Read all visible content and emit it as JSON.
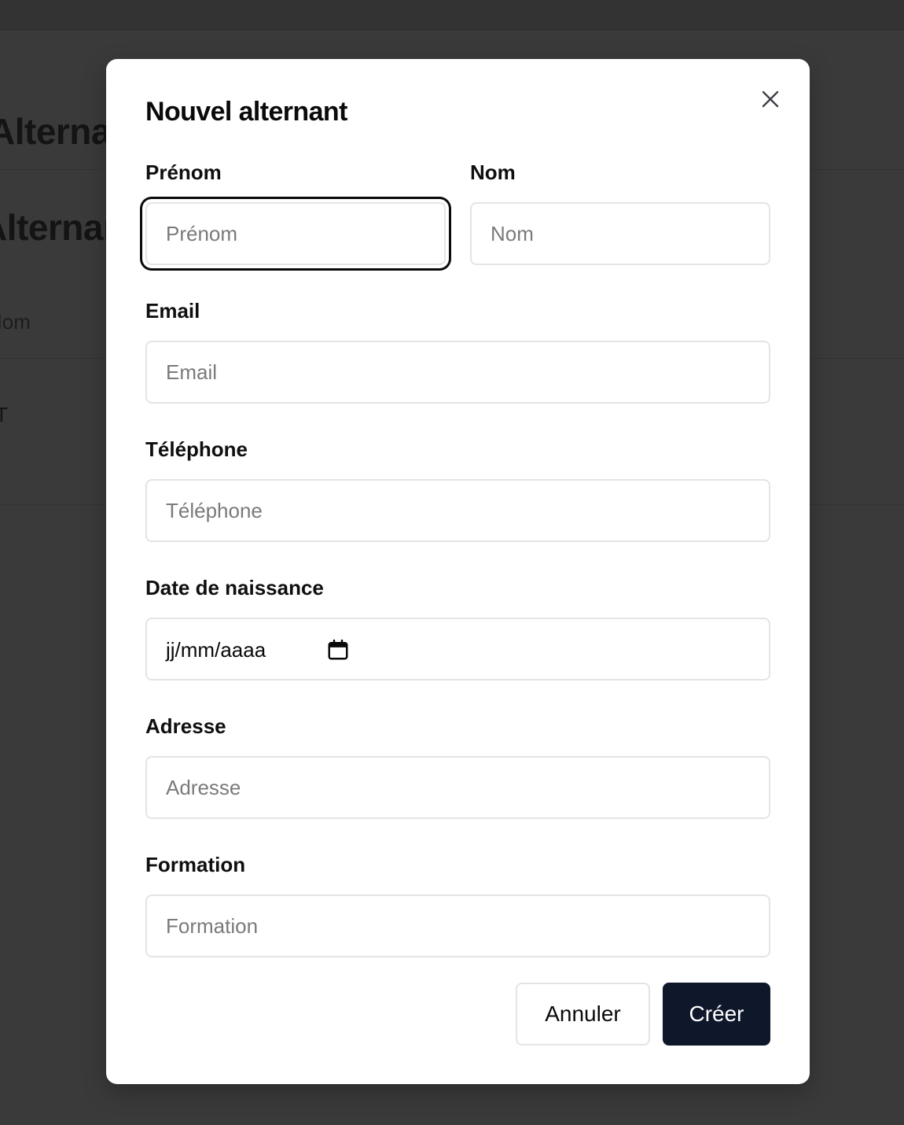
{
  "background": {
    "header_title": "Alternants",
    "section_title": "Alternants",
    "column_header": "Nom",
    "row_cell": "T"
  },
  "modal": {
    "title": "Nouvel alternant",
    "close_icon": "close-icon",
    "fields": {
      "prenom": {
        "label": "Prénom",
        "placeholder": "Prénom",
        "value": ""
      },
      "nom": {
        "label": "Nom",
        "placeholder": "Nom",
        "value": ""
      },
      "email": {
        "label": "Email",
        "placeholder": "Email",
        "value": ""
      },
      "telephone": {
        "label": "Téléphone",
        "placeholder": "Téléphone",
        "value": ""
      },
      "date_naissance": {
        "label": "Date de naissance",
        "display": "jj/mm/aaaa",
        "icon": "calendar-icon"
      },
      "adresse": {
        "label": "Adresse",
        "placeholder": "Adresse",
        "value": ""
      },
      "formation": {
        "label": "Formation",
        "placeholder": "Formation",
        "value": ""
      }
    },
    "buttons": {
      "cancel_label": "Annuler",
      "create_label": "Créer"
    }
  },
  "colors": {
    "overlay": "#3a3a3a",
    "primary": "#0f172a",
    "border": "#e4e4e7",
    "placeholder": "#7a7a7a"
  }
}
